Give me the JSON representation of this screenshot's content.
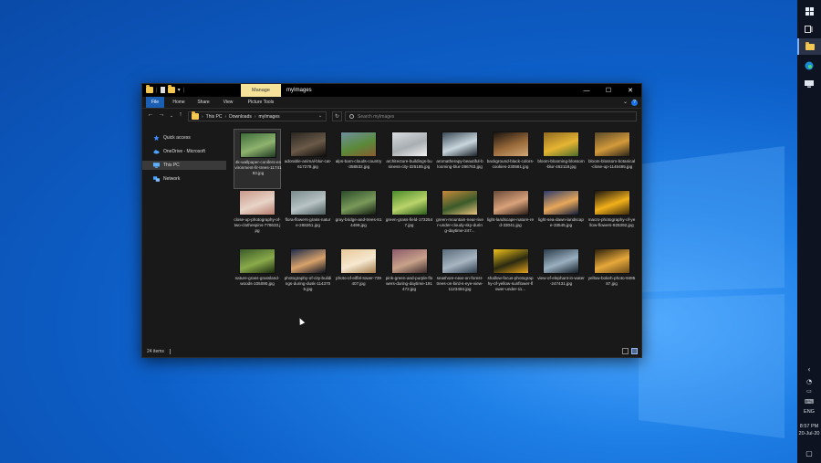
{
  "window": {
    "title": "myImages",
    "manage_tab": "Manage",
    "ribbon_tabs": [
      "File",
      "Home",
      "Share",
      "View",
      "Picture Tools"
    ],
    "help_icon": "?",
    "address": {
      "crumbs": [
        "This PC",
        "Downloads",
        "myImages"
      ]
    },
    "search_placeholder": "Search myImages",
    "status": "24 items"
  },
  "nav_pane": [
    {
      "label": "Quick access",
      "icon": "star-icon",
      "color": "#3d8bff"
    },
    {
      "label": "OneDrive - Microsoft",
      "icon": "cloud-icon",
      "color": "#4aa3ff"
    },
    {
      "label": "This PC",
      "icon": "pc-icon",
      "color": "#5db1ff"
    },
    {
      "label": "Network",
      "icon": "network-icon",
      "color": "#4aa3ff"
    }
  ],
  "files": [
    {
      "name": "4k-wallpaper-conifers-environment-fir-trees-1174183.jpg",
      "c1": "#3d6b3a",
      "c2": "#8fb36f",
      "c3": "#1e3820"
    },
    {
      "name": "adorable-animal-blur-cat-617278.jpg",
      "c1": "#2a2622",
      "c2": "#6a5a48",
      "c3": "#0e0c0a"
    },
    {
      "name": "alps-barn-clouds-country-358532.jpg",
      "c1": "#6f8f9f",
      "c2": "#5a8a3a",
      "c3": "#8a5a30"
    },
    {
      "name": "architecture-buildings-business-city-325185.jpg",
      "c1": "#d8dcdf",
      "c2": "#a9aeb2",
      "c3": "#f2f2f2"
    },
    {
      "name": "aromatherapy-beautiful-blooming-blur-286763.jpg",
      "c1": "#3a4a55",
      "c2": "#c9d6de",
      "c3": "#1a2228"
    },
    {
      "name": "background-black-colors-cookies-230581.jpg",
      "c1": "#1a1410",
      "c2": "#9a6a3a",
      "c3": "#d1a875"
    },
    {
      "name": "bloom-blooming-blossom-blur-462118.jpg",
      "c1": "#8f6a22",
      "c2": "#e6b532",
      "c3": "#4b6a2a"
    },
    {
      "name": "bloom-blossom-botanical-close-up-1146485.jpg",
      "c1": "#5a4a2a",
      "c2": "#d39a3a",
      "c3": "#2a2418"
    },
    {
      "name": "close-up-photography-of-two-clothespins-778633.jpg",
      "c1": "#c99a8a",
      "c2": "#e8d4c8",
      "c3": "#b57a6a"
    },
    {
      "name": "flora-flowers-grass-nature-268261.jpg",
      "c1": "#7a8a8a",
      "c2": "#b8c4c6",
      "c3": "#4a5a5a"
    },
    {
      "name": "gray-bridge-and-trees-814499.jpg",
      "c1": "#2a4a2a",
      "c2": "#7a9a5a",
      "c3": "#111a11"
    },
    {
      "name": "green-grass-field-1732547.jpg",
      "c1": "#4a8a2a",
      "c2": "#b9d46a",
      "c3": "#2a5a1a"
    },
    {
      "name": "green-mountain-near-river-under-cloudy-sky-during-daytime-247...",
      "c1": "#c98a3a",
      "c2": "#3a5a2a",
      "c3": "#e8c27a"
    },
    {
      "name": "light-landscape-nature-red-33041.jpg",
      "c1": "#6a4a3a",
      "c2": "#d9a27a",
      "c3": "#2a1a14"
    },
    {
      "name": "light-sea-dawn-landscape-33545.jpg",
      "c1": "#2a3a6a",
      "c2": "#e8a85a",
      "c3": "#0e1a3a"
    },
    {
      "name": "macro-photography-of-yellow-flowers-925392.jpg",
      "c1": "#1a1410",
      "c2": "#f2b01a",
      "c3": "#3a2a10"
    },
    {
      "name": "nature-grass-grassland-woods-105090.jpg",
      "c1": "#3a5a2a",
      "c2": "#8aaa4a",
      "c3": "#1a2a10"
    },
    {
      "name": "photography-of-city-buildings-during-dusk-1143705.jpg",
      "c1": "#1a2a4a",
      "c2": "#d8a26a",
      "c3": "#0a1020"
    },
    {
      "name": "photo-of-eiffel-tower-739407.jpg",
      "c1": "#e8c89a",
      "c2": "#f6e8d0",
      "c3": "#a07a4a"
    },
    {
      "name": "pink-green-and-purple-flowers-during-daytime-191472.jpg",
      "c1": "#8a5a6a",
      "c2": "#c9a28a",
      "c3": "#3a2a2a"
    },
    {
      "name": "seashore-near-on-forest-trees-on-bird-s-eye-view-1123484.jpg",
      "c1": "#5a6a7a",
      "c2": "#a8b6c2",
      "c3": "#2a3a4a"
    },
    {
      "name": "shallow-focus-photography-of-yellow-sunflower-flower-under-11...",
      "c1": "#f2c21a",
      "c2": "#2a2a10",
      "c3": "#e6a21a"
    },
    {
      "name": "view-of-elephant-in-water-247431.jpg",
      "c1": "#2a3a4a",
      "c2": "#9ab0c0",
      "c3": "#141e28"
    },
    {
      "name": "yellow-bokeh-photo-949587.jpg",
      "c1": "#2a1e0a",
      "c2": "#e6a83a",
      "c3": "#6a4a1a"
    }
  ],
  "taskbar": {
    "language": "ENG",
    "time": "8:57 PM",
    "date": "20-Jul-20",
    "icons": [
      "windows-start-icon",
      "task-view-icon",
      "file-explorer-icon",
      "edge-icon",
      "monitor-icon"
    ]
  },
  "colors": {
    "accent": "#1a5fb4",
    "manage_tab": "#f5e39a",
    "desktop": "#0d5fc8"
  }
}
